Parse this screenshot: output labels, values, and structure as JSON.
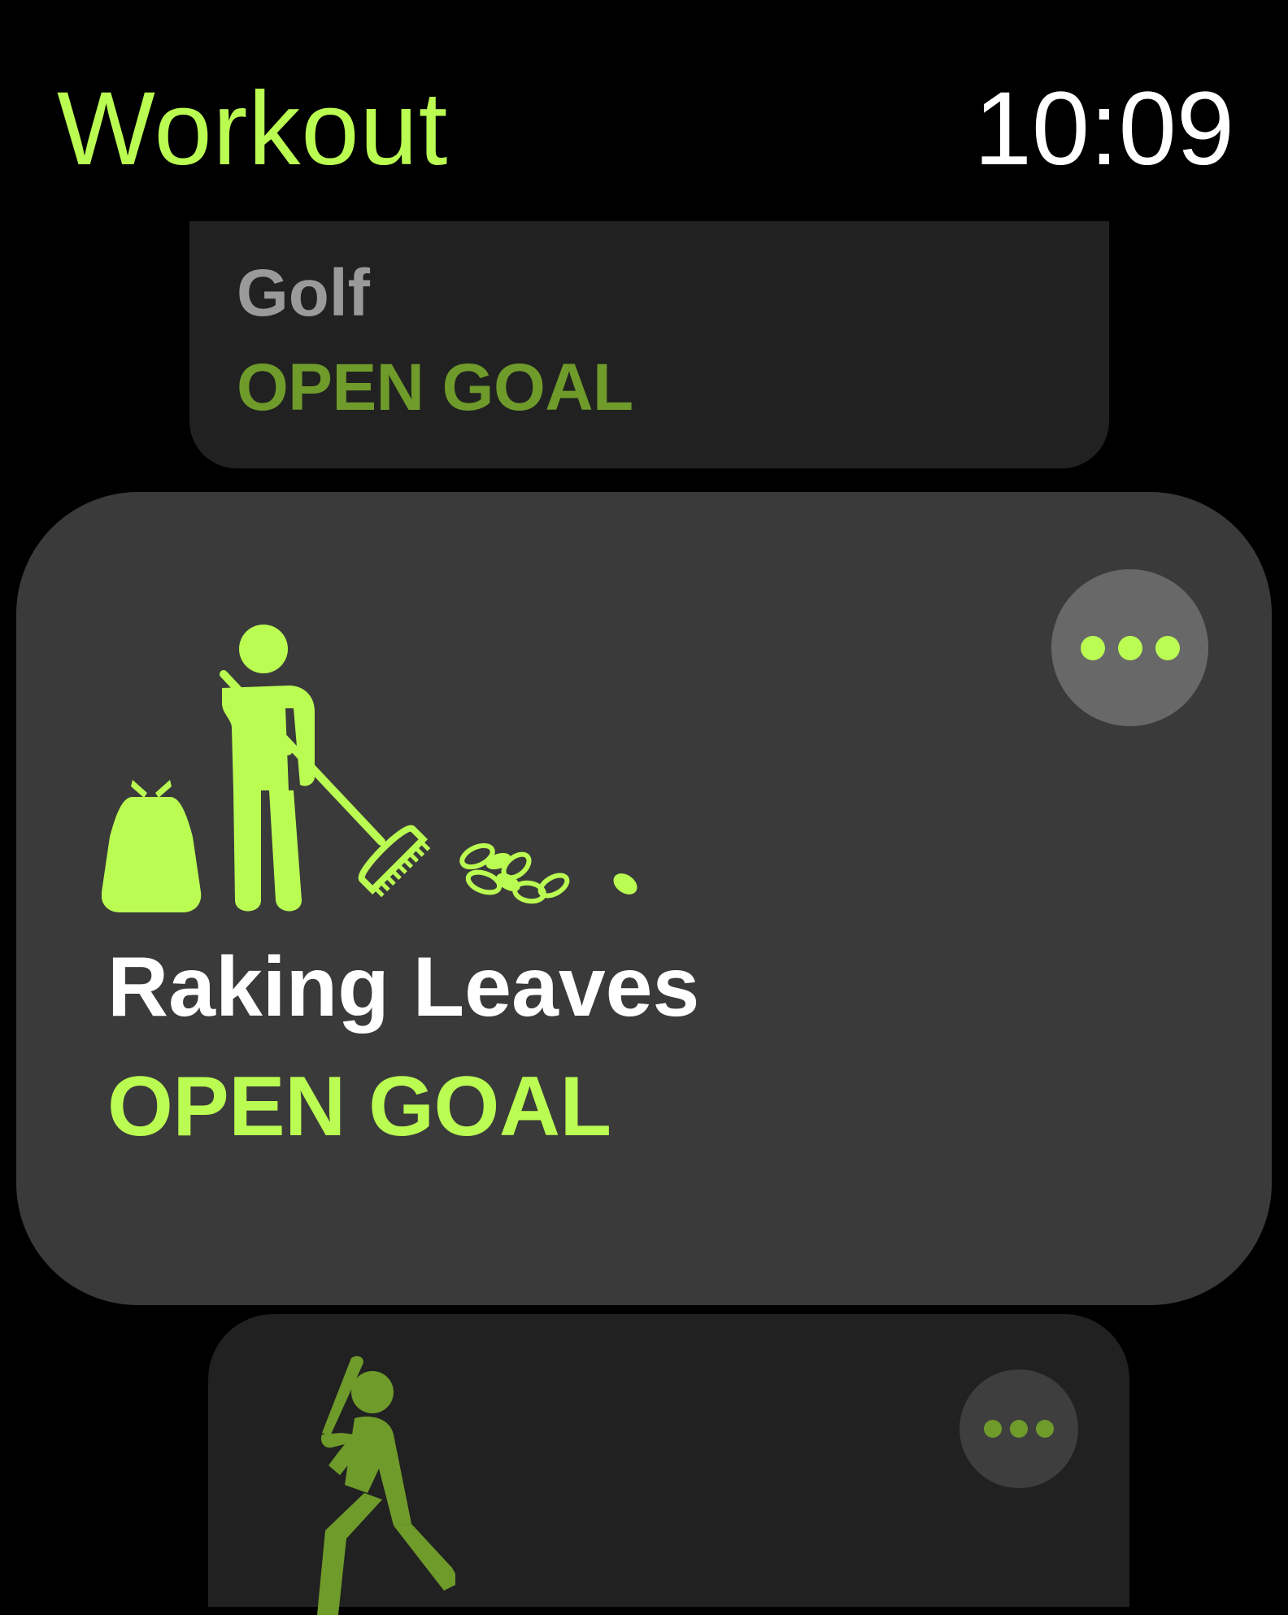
{
  "colors": {
    "accent": "#bbfc52",
    "accent_dim": "#6f9b2b",
    "background": "#000000",
    "card_focused": "#3a3a3a",
    "card_dim": "#212121"
  },
  "header": {
    "title": "Workout",
    "time": "10:09"
  },
  "workouts": [
    {
      "name": "Golf",
      "goal": "OPEN GOAL",
      "icon": "golf-icon",
      "state": "dimmed"
    },
    {
      "name": "Raking Leaves",
      "goal": "OPEN GOAL",
      "icon": "raking-leaves-icon",
      "more_icon": "ellipsis-icon",
      "state": "focused"
    },
    {
      "name": "",
      "goal": "",
      "icon": "baseball-icon",
      "more_icon": "ellipsis-icon",
      "state": "dimmed"
    }
  ]
}
